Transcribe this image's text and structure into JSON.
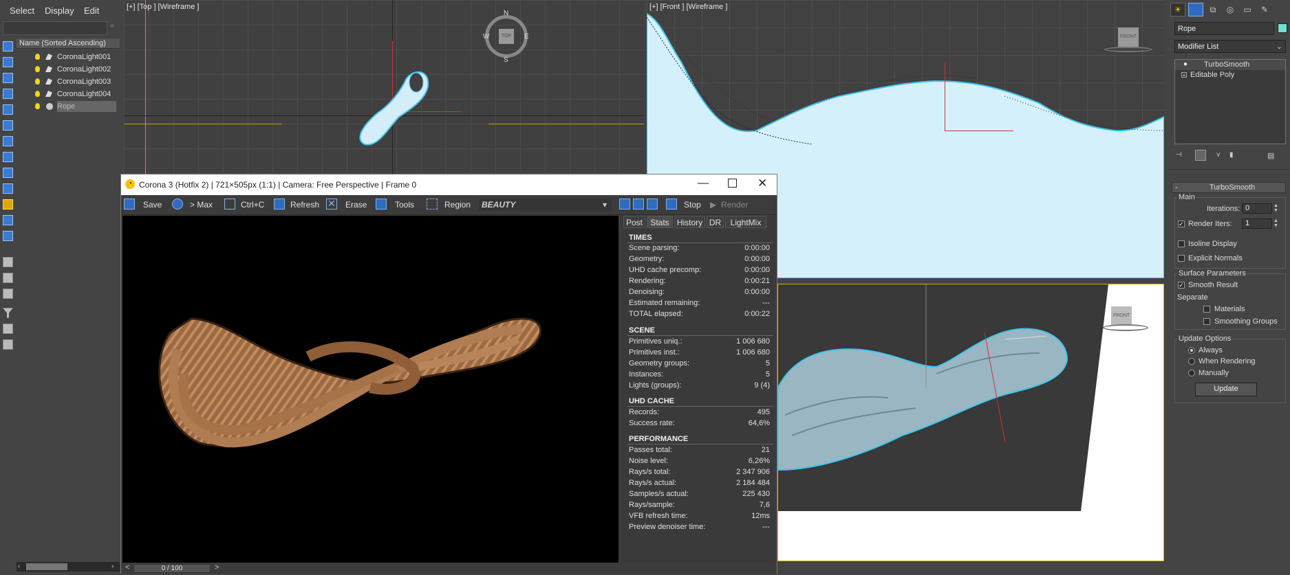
{
  "menu": {
    "select": "Select",
    "display": "Display",
    "edit": "Edit"
  },
  "explorer": {
    "header": "Name (Sorted Ascending)",
    "items": [
      {
        "label": "CoronaLight001",
        "type": "light"
      },
      {
        "label": "CoronaLight002",
        "type": "light"
      },
      {
        "label": "CoronaLight003",
        "type": "light"
      },
      {
        "label": "CoronaLight004",
        "type": "light"
      },
      {
        "label": "Rope",
        "type": "geometry",
        "selected": true
      }
    ]
  },
  "viewports": {
    "top_label": "[+] [Top ] [Wireframe ]",
    "front_label": "[+] [Front ] [Wireframe ]",
    "compass": {
      "n": "N",
      "s": "S",
      "e": "E",
      "w": "W",
      "cube": "TOP"
    },
    "front_cube": "FRONT",
    "persp_cube": "FRONT"
  },
  "command_panel": {
    "object_name": "Rope",
    "object_color": "#6fe0d0",
    "modifier_list": "Modifier List",
    "stack": [
      {
        "label": "TurboSmooth",
        "active": true
      },
      {
        "label": "Editable Poly",
        "active": false
      }
    ],
    "rollout_title": "TurboSmooth",
    "main_group": "Main",
    "iterations_label": "Iterations:",
    "iterations_value": "0",
    "render_iters_label": "Render Iters:",
    "render_iters_value": "1",
    "isoline_label": "Isoline Display",
    "explicit_normals_label": "Explicit Normals",
    "surface_group": "Surface Parameters",
    "smooth_result_label": "Smooth Result",
    "separate_label": "Separate",
    "materials_label": "Materials",
    "smoothing_groups_label": "Smoothing Groups",
    "update_group": "Update Options",
    "always_label": "Always",
    "when_rendering_label": "When Rendering",
    "manually_label": "Manually",
    "update_button": "Update"
  },
  "vfb": {
    "title": "Corona 3 (Hotfix 2) | 721×505px (1:1) | Camera: Free Perspective | Frame 0",
    "toolbar": {
      "save": "Save",
      "to_max": "> Max",
      "copy": "Ctrl+C",
      "refresh": "Refresh",
      "erase": "Erase",
      "tools": "Tools",
      "region": "Region",
      "channel": "BEAUTY",
      "stop": "Stop",
      "render": "Render"
    },
    "tabs": [
      "Post",
      "Stats",
      "History",
      "DR",
      "LightMix"
    ],
    "active_tab": "Stats",
    "sections": [
      {
        "title": "TIMES",
        "rows": [
          [
            "Scene parsing:",
            "0:00:00"
          ],
          [
            "Geometry:",
            "0:00:00"
          ],
          [
            "UHD cache precomp:",
            "0:00:00"
          ],
          [
            "Rendering:",
            "0:00:21"
          ],
          [
            "Denoising:",
            "0:00:00"
          ],
          [
            "Estimated remaining:",
            "---"
          ],
          [
            "TOTAL elapsed:",
            "0:00:22"
          ]
        ]
      },
      {
        "title": "SCENE",
        "rows": [
          [
            "Primitives uniq.:",
            "1 006 680"
          ],
          [
            "Primitives inst.:",
            "1 006 680"
          ],
          [
            "Geometry groups:",
            "5"
          ],
          [
            "Instances:",
            "5"
          ],
          [
            "Lights (groups):",
            "9 (4)"
          ]
        ]
      },
      {
        "title": "UHD CACHE",
        "rows": [
          [
            "Records:",
            "495"
          ],
          [
            "Success rate:",
            "64,6%"
          ]
        ]
      },
      {
        "title": "PERFORMANCE",
        "rows": [
          [
            "Passes total:",
            "21"
          ],
          [
            "Noise level:",
            "6,26%"
          ],
          [
            "Rays/s total:",
            "2 347 906"
          ],
          [
            "Rays/s actual:",
            "2 184 484"
          ],
          [
            "Samples/s actual:",
            "225 430"
          ],
          [
            "Rays/sample:",
            "7,6"
          ],
          [
            "VFB refresh time:",
            "12ms"
          ],
          [
            "Preview denoiser time:",
            "---"
          ]
        ]
      }
    ]
  },
  "timeline": {
    "frame": "0 / 100",
    "prev": "<",
    "next": ">"
  }
}
